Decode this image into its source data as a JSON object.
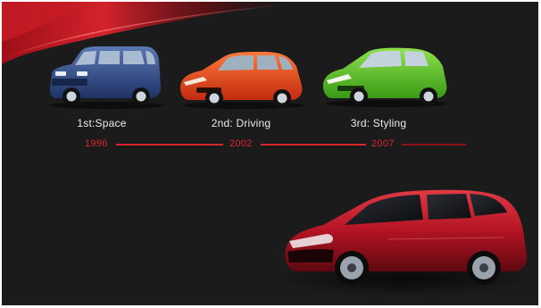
{
  "slide": {
    "generations": [
      {
        "caption": "1st:Space",
        "year": "1996",
        "color": "#2e4a86"
      },
      {
        "caption": "2nd: Driving",
        "year": "2002",
        "color": "#e8451e"
      },
      {
        "caption": "3rd: Styling",
        "year": "2007",
        "color": "#5fc12a"
      }
    ],
    "hero_color": "#b31424",
    "accent_color": "#d8262e",
    "background_color": "#1b1b1b"
  }
}
